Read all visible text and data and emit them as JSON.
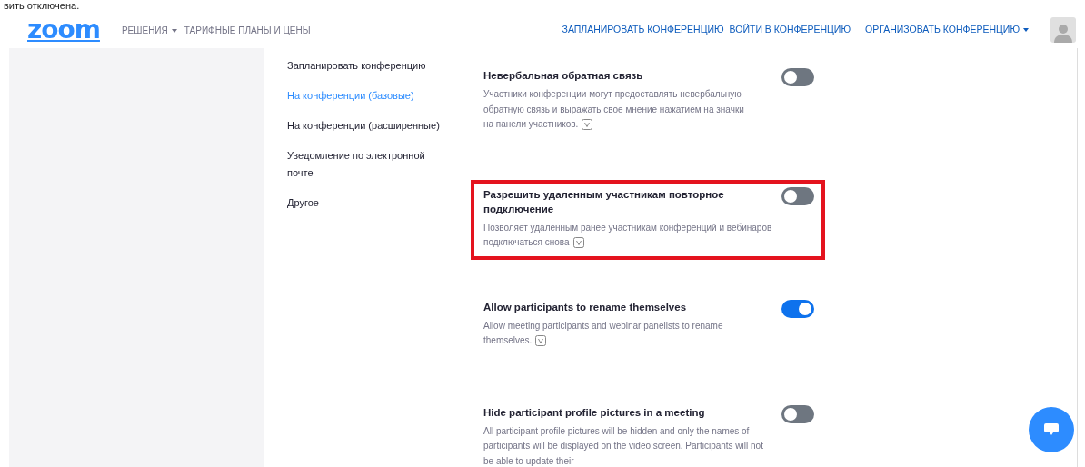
{
  "top_caption": "вить отключена.",
  "navbar": {
    "logo": "zoom",
    "left_links": [
      {
        "label": "РЕШЕНИЯ",
        "dropdown": true
      },
      {
        "label": "ТАРИФНЫЕ ПЛАНЫ И ЦЕНЫ",
        "dropdown": false
      }
    ],
    "right_links": [
      {
        "label": "ЗАПЛАНИРОВАТЬ КОНФЕРЕНЦИЮ",
        "dropdown": false
      },
      {
        "label": "ВОЙТИ В КОНФЕРЕНЦИЮ",
        "dropdown": false
      },
      {
        "label": "ОРГАНИЗОВАТЬ КОНФЕРЕНЦИЮ",
        "dropdown": true
      }
    ]
  },
  "sections_nav": [
    {
      "label": "Запланировать конференцию",
      "selected": false
    },
    {
      "label": "На конференции (базовые)",
      "selected": true
    },
    {
      "label": "На конференции (расширенные)",
      "selected": false
    },
    {
      "label": "Уведомление по электронной почте",
      "selected": false
    },
    {
      "label": "Другое",
      "selected": false
    }
  ],
  "settings": [
    {
      "title": "Невербальная обратная связь",
      "description": "Участники конференции могут предоставлять невербальную обратную связь и выражать свое мнение нажатием на значки на панели участников.",
      "on": false,
      "highlighted": false,
      "info_icon": true
    },
    {
      "title": "Разрешить удаленным участникам повторное подключение",
      "description": "Позволяет удаленным ранее участникам конференций и вебинаров подключаться снова",
      "on": false,
      "highlighted": true,
      "info_icon": true
    },
    {
      "title": "Allow participants to rename themselves",
      "description": "Allow meeting participants and webinar panelists to rename themselves.",
      "on": true,
      "highlighted": false,
      "info_icon": true
    },
    {
      "title": "Hide participant profile pictures in a meeting",
      "description": "All participant profile pictures will be hidden and only the names of participants will be displayed on the video screen. Participants will not be able to update their",
      "on": false,
      "highlighted": false,
      "info_icon": false
    }
  ]
}
